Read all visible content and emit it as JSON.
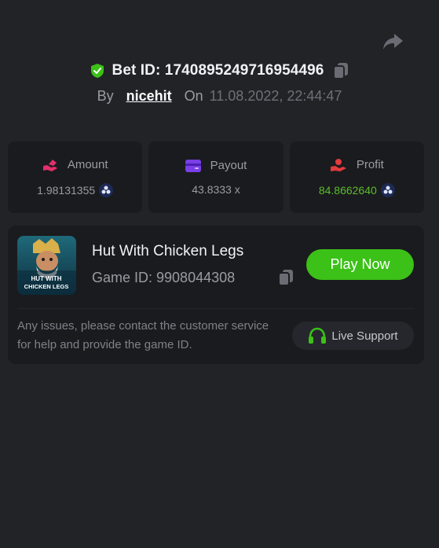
{
  "header": {
    "bet_id": "Bet ID: 1740895249716954496",
    "by_label": "By",
    "username": "nicehit",
    "on_label": "On",
    "date": "11.08.2022, 22:44:47",
    "icons": {
      "share": "share-arrow-icon",
      "verified": "verified-shield-icon",
      "copy": "copy-icon"
    }
  },
  "stats": {
    "amount": {
      "label": "Amount",
      "value": "1.98131355",
      "icon": "amount-hand-icon",
      "coin": "coin-icon"
    },
    "payout": {
      "label": "Payout",
      "value": "43.8333 x",
      "icon": "wallet-card-icon"
    },
    "profit": {
      "label": "Profit",
      "value": "84.8662640",
      "icon": "profit-hand-icon",
      "coin": "coin-icon"
    }
  },
  "game": {
    "title": "Hut With Chicken Legs",
    "game_id": "Game ID: 9908044308",
    "play_label": "Play Now",
    "thumb_text_line1": "HUT WITH",
    "thumb_text_line2": "CHICKEN LEGS",
    "issues_text": "Any issues, please contact the customer service for help and provide the game ID.",
    "support_label": "Live Support"
  },
  "colors": {
    "background": "#222327",
    "card": "#1a1b1e",
    "accent_green": "#3bc117",
    "profit_green": "#5bbd2b",
    "amount_pink": "#e0306a",
    "payout_purple": "#7a3fe6",
    "profit_red": "#e23b3b"
  }
}
